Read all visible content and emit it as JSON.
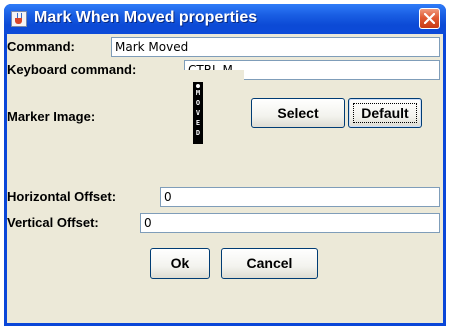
{
  "window": {
    "title": "Mark When Moved properties"
  },
  "fields": {
    "command": {
      "label": "Command:",
      "value": "Mark Moved"
    },
    "keyboard": {
      "label": "Keyboard command:",
      "value": "CTRL M"
    },
    "marker": {
      "label": "Marker Image:",
      "image_text": [
        "M",
        "O",
        "V",
        "E",
        "D"
      ]
    },
    "horizontal_offset": {
      "label": "Horizontal Offset:",
      "value": "0"
    },
    "vertical_offset": {
      "label": "Vertical Offset:",
      "value": "0"
    }
  },
  "buttons": {
    "select": "Select",
    "default": "Default",
    "ok": "Ok",
    "cancel": "Cancel"
  },
  "colors": {
    "titlebar": "#0c4ad6",
    "client": "#ece9d8",
    "close": "#e05a34"
  }
}
